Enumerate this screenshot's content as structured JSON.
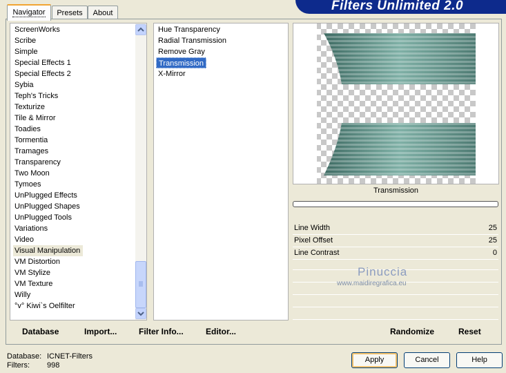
{
  "title": "Filters Unlimited 2.0",
  "tabs": [
    {
      "label": "Navigator",
      "active": true
    },
    {
      "label": "Presets",
      "active": false
    },
    {
      "label": "About",
      "active": false
    }
  ],
  "categories": [
    "ScreenWorks",
    "Scribe",
    "Simple",
    "Special Effects 1",
    "Special Effects 2",
    "Sybia",
    "Teph's Tricks",
    "Texturize",
    "Tile & Mirror",
    "Toadies",
    "Tormentia",
    "Tramages",
    "Transparency",
    "Two Moon",
    "Tymoes",
    "UnPlugged Effects",
    "UnPlugged Shapes",
    "UnPlugged Tools",
    "Variations",
    "Video",
    "Visual Manipulation",
    "VM Distortion",
    "VM Stylize",
    "VM Texture",
    "Willy",
    "°v° Kiwi`s Oelfilter"
  ],
  "selected_category": "Visual Manipulation",
  "filters": [
    "Hue Transparency",
    "Radial Transmission",
    "Remove Gray",
    "Transmission",
    "X-Mirror"
  ],
  "selected_filter": "Transmission",
  "preview_label": "Transmission",
  "params": [
    {
      "label": "Line Width",
      "value": "25"
    },
    {
      "label": "Pixel Offset",
      "value": "25"
    },
    {
      "label": "Line Contrast",
      "value": "0"
    }
  ],
  "watermark": {
    "line1": "Pinuccia",
    "line2": "www.maidiregrafica.eu"
  },
  "bottom_left_buttons": {
    "database": "Database",
    "import": "Import...",
    "filter_info": "Filter Info...",
    "editor": "Editor..."
  },
  "bottom_right_buttons": {
    "randomize": "Randomize",
    "reset": "Reset"
  },
  "status": {
    "database_label": "Database:",
    "database_value": "ICNET-Filters",
    "filters_label": "Filters:",
    "filters_value": "998"
  },
  "dialog_buttons": {
    "apply": "Apply",
    "cancel": "Cancel",
    "help": "Help"
  },
  "colors": {
    "accent": "#0d2a8c",
    "selection": "#316ac5",
    "preview_fill": "#5f8f87"
  }
}
